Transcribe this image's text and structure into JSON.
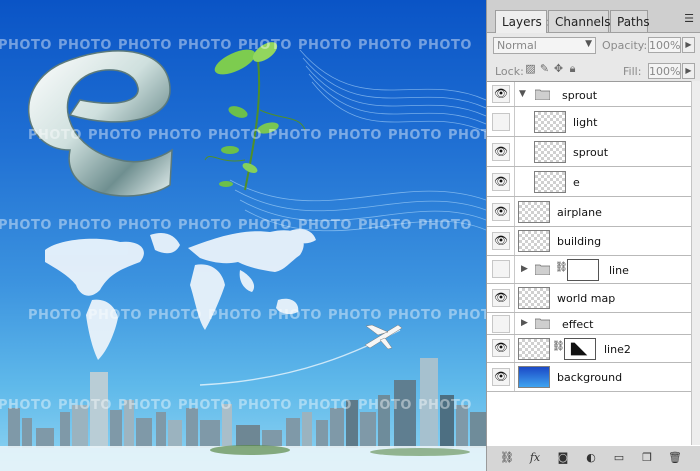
{
  "canvas": {
    "watermark_text": "PHOTO",
    "colors": {
      "sky_top": "#0a54c6",
      "sky_bottom": "#8fd4f2",
      "map": "#eaf3fb",
      "leaf": "#6cc04a"
    }
  },
  "panel": {
    "tabs": [
      {
        "label": "Layers",
        "close": "×",
        "active": true
      },
      {
        "label": "Channels",
        "active": false
      },
      {
        "label": "Paths",
        "active": false
      }
    ],
    "menu_icon": "panel-menu-icon",
    "blend_mode": "Normal",
    "opacity_label": "Opacity:",
    "opacity_value": "100%",
    "lock_label": "Lock:",
    "fill_label": "Fill:",
    "fill_value": "100%",
    "layers": [
      {
        "name": "sprout",
        "type": "group-open",
        "visible": true
      },
      {
        "name": "light",
        "type": "layer-indented",
        "visible": false
      },
      {
        "name": "sprout",
        "type": "layer-indented",
        "visible": true
      },
      {
        "name": "e",
        "type": "layer-indented",
        "visible": true
      },
      {
        "name": "airplane",
        "type": "layer",
        "visible": true
      },
      {
        "name": "building",
        "type": "layer",
        "visible": true
      },
      {
        "name": "line",
        "type": "group-mask",
        "visible": false
      },
      {
        "name": "world map",
        "type": "layer",
        "visible": true
      },
      {
        "name": "effect",
        "type": "group-closed",
        "visible": false
      },
      {
        "name": "line2",
        "type": "layer-mask",
        "visible": true
      },
      {
        "name": "background",
        "type": "layer-blue",
        "visible": true
      }
    ],
    "bottom_icons": [
      "link-icon",
      "fx-icon",
      "mask-icon",
      "adjustment-icon",
      "new-group-icon",
      "new-layer-icon",
      "trash-icon"
    ]
  }
}
